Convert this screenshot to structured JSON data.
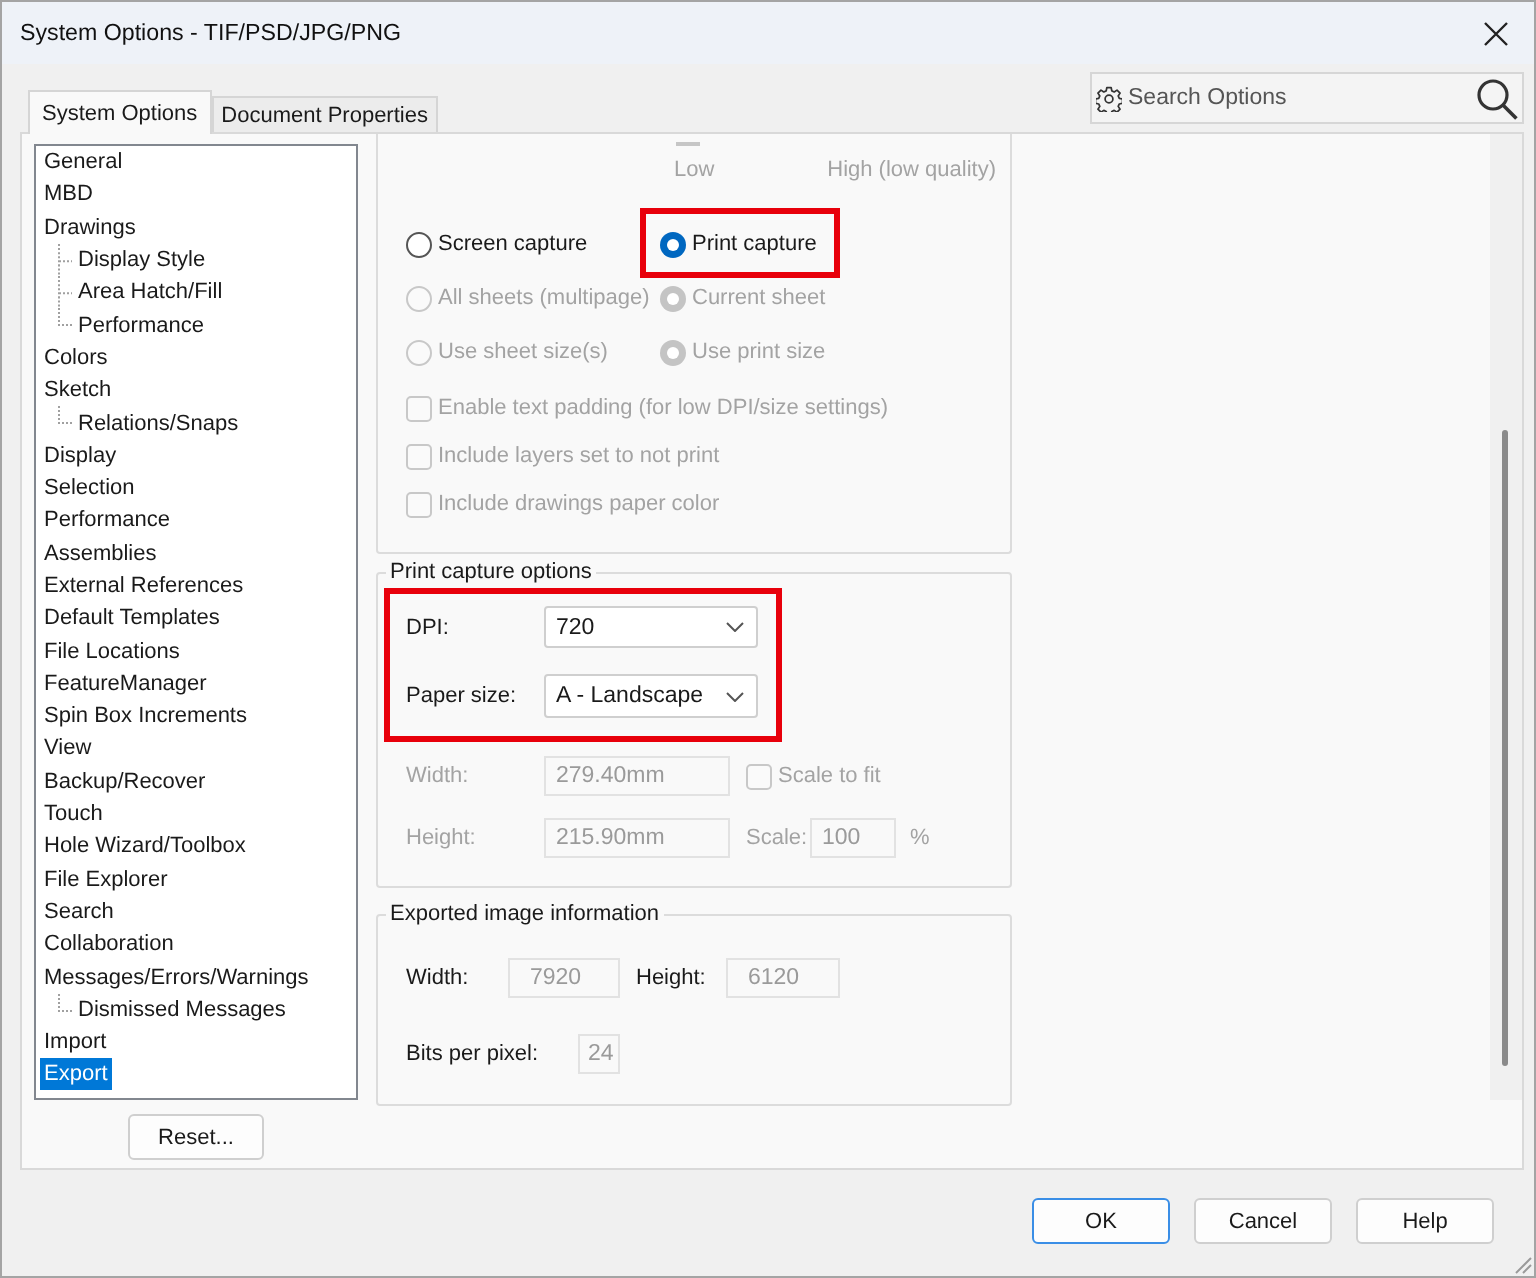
{
  "window": {
    "title": "System Options - TIF/PSD/JPG/PNG"
  },
  "tabs": [
    {
      "label": "System Options",
      "selected": true
    },
    {
      "label": "Document Properties",
      "selected": false
    }
  ],
  "search": {
    "placeholder": "Search Options"
  },
  "sidebar": {
    "items": [
      {
        "label": "General",
        "selected": false
      },
      {
        "label": "MBD",
        "selected": false
      },
      {
        "label": "Drawings",
        "selected": false,
        "children": [
          {
            "label": "Display Style",
            "selected": false
          },
          {
            "label": "Area Hatch/Fill",
            "selected": false
          },
          {
            "label": "Performance",
            "selected": false
          }
        ]
      },
      {
        "label": "Colors",
        "selected": false
      },
      {
        "label": "Sketch",
        "selected": false,
        "children": [
          {
            "label": "Relations/Snaps",
            "selected": false
          }
        ]
      },
      {
        "label": "Display",
        "selected": false
      },
      {
        "label": "Selection",
        "selected": false
      },
      {
        "label": "Performance",
        "selected": false
      },
      {
        "label": "Assemblies",
        "selected": false
      },
      {
        "label": "External References",
        "selected": false
      },
      {
        "label": "Default Templates",
        "selected": false
      },
      {
        "label": "File Locations",
        "selected": false
      },
      {
        "label": "FeatureManager",
        "selected": false
      },
      {
        "label": "Spin Box Increments",
        "selected": false
      },
      {
        "label": "View",
        "selected": false
      },
      {
        "label": "Backup/Recover",
        "selected": false
      },
      {
        "label": "Touch",
        "selected": false
      },
      {
        "label": "Hole Wizard/Toolbox",
        "selected": false
      },
      {
        "label": "File Explorer",
        "selected": false
      },
      {
        "label": "Search",
        "selected": false
      },
      {
        "label": "Collaboration",
        "selected": false
      },
      {
        "label": "Messages/Errors/Warnings",
        "selected": false,
        "children": [
          {
            "label": "Dismissed Messages",
            "selected": false
          }
        ]
      },
      {
        "label": "Import",
        "selected": false
      },
      {
        "label": "Export",
        "selected": true
      }
    ]
  },
  "reset_button": {
    "label": "Reset..."
  },
  "image_quality": {
    "low_label": "Low",
    "high_label": "High (low quality)",
    "disabled": true
  },
  "capture_modes": [
    {
      "label": "Screen capture",
      "selected": false,
      "disabled": false,
      "highlighted": false
    },
    {
      "label": "Print capture",
      "selected": true,
      "disabled": false,
      "highlighted": true
    }
  ],
  "sheet_options": [
    {
      "label": "All sheets (multipage)",
      "selected": false,
      "disabled": true
    },
    {
      "label": "Current sheet",
      "selected": true,
      "disabled": true
    }
  ],
  "size_options": [
    {
      "label": "Use sheet size(s)",
      "selected": false,
      "disabled": true
    },
    {
      "label": "Use print size",
      "selected": true,
      "disabled": true
    }
  ],
  "checkboxes": [
    {
      "label": "Enable text padding (for low DPI/size settings)",
      "checked": false,
      "disabled": true
    },
    {
      "label": "Include layers set to not print",
      "checked": false,
      "disabled": true
    },
    {
      "label": "Include drawings paper color",
      "checked": false,
      "disabled": true
    }
  ],
  "print_capture_options": {
    "legend": "Print capture options",
    "dropdowns": {
      "highlighted": true,
      "items": [
        {
          "label": "DPI:",
          "value": "720"
        },
        {
          "label": "Paper size:",
          "value": "A - Landscape"
        }
      ]
    },
    "width": {
      "label": "Width:",
      "value": "279.40mm",
      "disabled": true
    },
    "scale_to_fit": {
      "label": "Scale to fit",
      "checked": false,
      "disabled": true
    },
    "height": {
      "label": "Height:",
      "value": "215.90mm",
      "disabled": true
    },
    "scale": {
      "label": "Scale:",
      "value": "100",
      "unit": "%",
      "disabled": true
    }
  },
  "exported_image_information": {
    "legend": "Exported image information",
    "width": {
      "label": "Width:",
      "value": "7920",
      "read_only": true
    },
    "height": {
      "label": "Height:",
      "value": "6120",
      "read_only": true
    },
    "bits_per_pixel": {
      "label": "Bits per pixel:",
      "value": "24",
      "read_only": true
    }
  },
  "buttons": [
    {
      "label": "OK",
      "default": true
    },
    {
      "label": "Cancel",
      "default": false
    },
    {
      "label": "Help",
      "default": false
    }
  ]
}
